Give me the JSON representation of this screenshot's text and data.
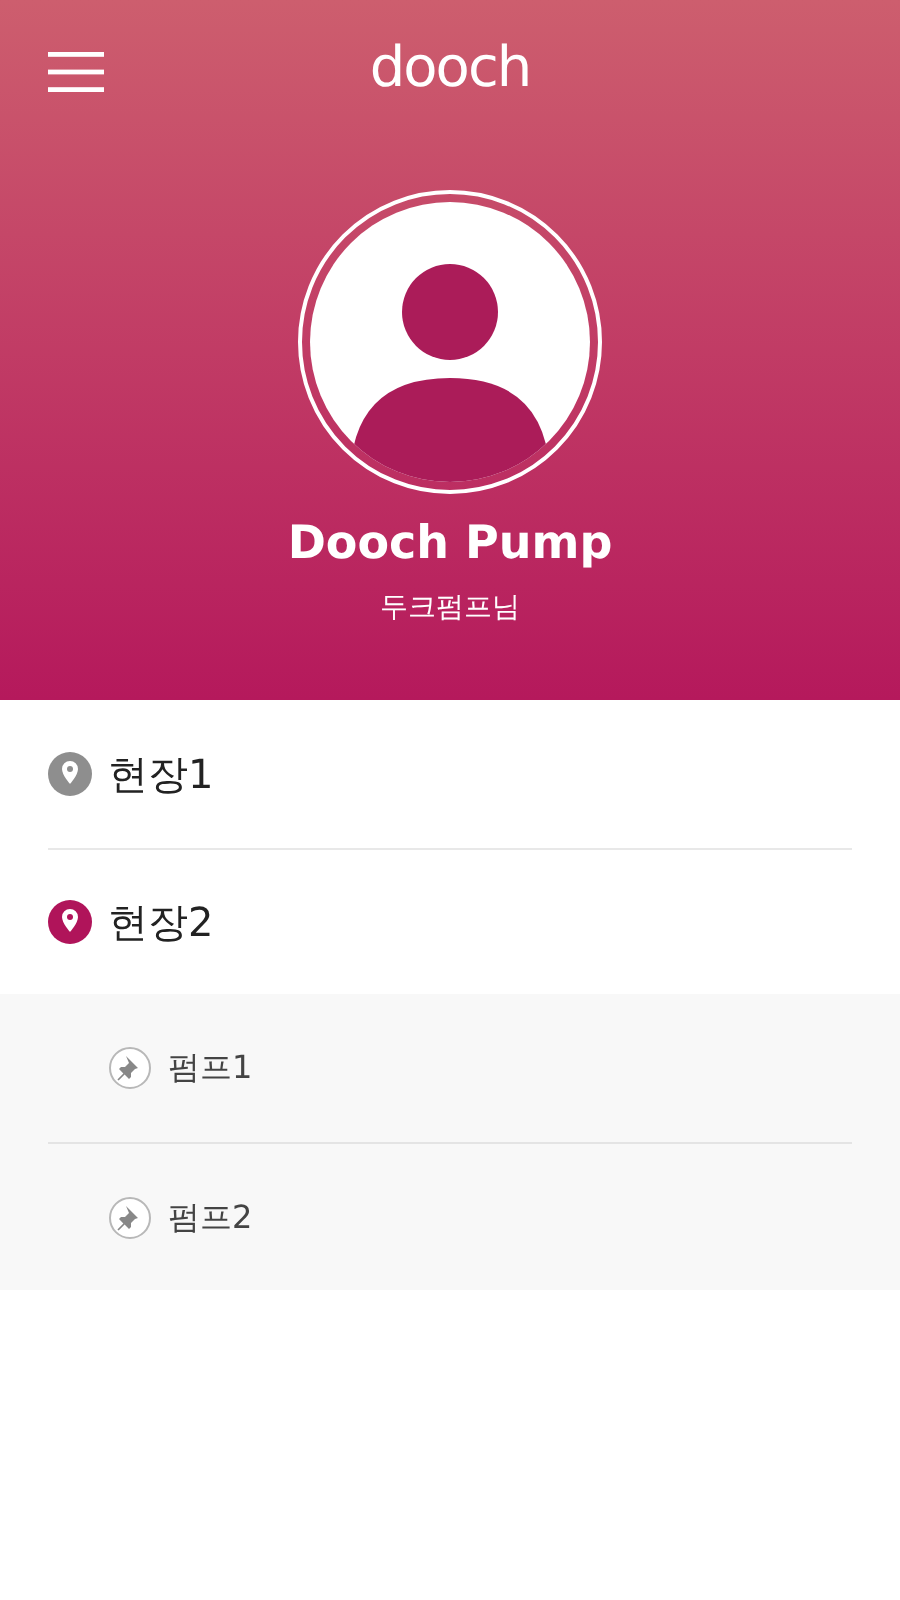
{
  "header": {
    "logo": "dooch",
    "profile": {
      "name": "Dooch Pump",
      "subtitle": "두크펌프님"
    }
  },
  "sites": [
    {
      "label": "현장1",
      "selected": false,
      "expanded": false
    },
    {
      "label": "현장2",
      "selected": true,
      "expanded": true,
      "children": [
        {
          "label": "펌프1"
        },
        {
          "label": "펌프2"
        }
      ]
    }
  ]
}
